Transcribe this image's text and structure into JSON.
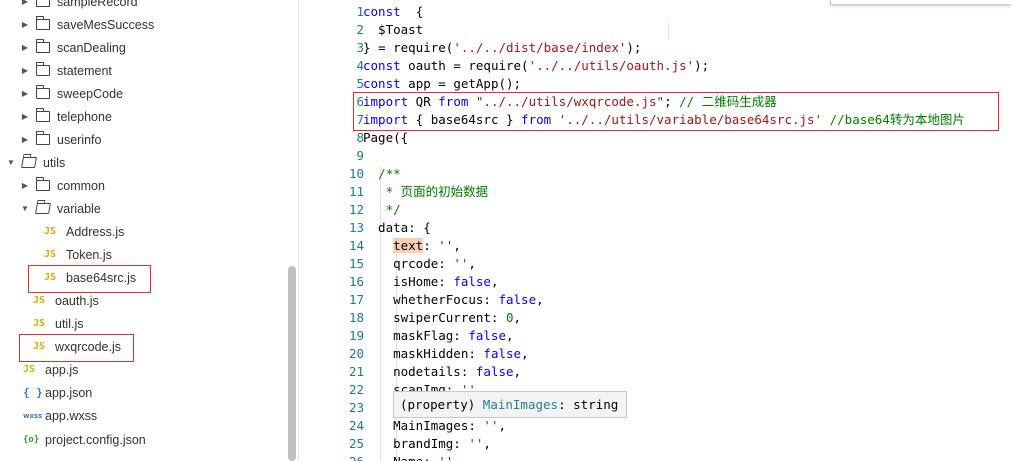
{
  "explorer": {
    "items": [
      {
        "label": "sampleRecord",
        "kind": "folder",
        "arrow": "▶"
      },
      {
        "label": "saveMesSuccess",
        "kind": "folder",
        "arrow": "▶"
      },
      {
        "label": "scanDealing",
        "kind": "folder",
        "arrow": "▶"
      },
      {
        "label": "statement",
        "kind": "folder",
        "arrow": "▶"
      },
      {
        "label": "sweepCode",
        "kind": "folder",
        "arrow": "▶"
      },
      {
        "label": "telephone",
        "kind": "folder",
        "arrow": "▶"
      },
      {
        "label": "userinfo",
        "kind": "folder",
        "arrow": "▶"
      },
      {
        "label": "utils",
        "kind": "folder-open",
        "arrow": "▼"
      },
      {
        "label": "common",
        "kind": "folder",
        "arrow": "▶"
      },
      {
        "label": "variable",
        "kind": "folder-open",
        "arrow": "▼"
      },
      {
        "label": "Address.js",
        "kind": "js",
        "icon_text": "JS"
      },
      {
        "label": "Token.js",
        "kind": "js",
        "icon_text": "JS"
      },
      {
        "label": "base64src.js",
        "kind": "js",
        "icon_text": "JS",
        "highlighted": true
      },
      {
        "label": "oauth.js",
        "kind": "js",
        "icon_text": "JS"
      },
      {
        "label": "util.js",
        "kind": "js",
        "icon_text": "JS"
      },
      {
        "label": "wxqrcode.js",
        "kind": "js",
        "icon_text": "JS",
        "highlighted": true
      },
      {
        "label": "app.js",
        "kind": "js",
        "icon_text": "JS"
      },
      {
        "label": "app.json",
        "kind": "json",
        "icon_text": "{ }"
      },
      {
        "label": "app.wxss",
        "kind": "wxss",
        "icon_text": "wxss"
      },
      {
        "label": "project.config.json",
        "kind": "cfg",
        "icon_text": "{o}"
      }
    ]
  },
  "editor": {
    "lines": [
      {
        "n": "1",
        "tokens": [
          [
            "kw",
            "const"
          ],
          [
            "",
            "  {"
          ]
        ]
      },
      {
        "n": "2",
        "tokens": [
          [
            "",
            "  $Toast"
          ]
        ]
      },
      {
        "n": "3",
        "tokens": [
          [
            "",
            "} = require("
          ],
          [
            "str",
            "'../../dist/base/index'"
          ],
          [
            "",
            ");"
          ]
        ]
      },
      {
        "n": "4",
        "tokens": [
          [
            "kw",
            "const"
          ],
          [
            "",
            " oauth = require("
          ],
          [
            "str",
            "'../../utils/oauth.js'"
          ],
          [
            "",
            ");"
          ]
        ]
      },
      {
        "n": "5",
        "tokens": [
          [
            "kw",
            "const"
          ],
          [
            "",
            " app = getApp();"
          ]
        ]
      },
      {
        "n": "6",
        "tokens": [
          [
            "kw",
            "import"
          ],
          [
            "",
            " QR "
          ],
          [
            "kw",
            "from"
          ],
          [
            "",
            " "
          ],
          [
            "str",
            "\"../../utils/wxqrcode.js\""
          ],
          [
            "",
            "; "
          ],
          [
            "cm",
            "// 二维码生成器"
          ]
        ]
      },
      {
        "n": "7",
        "tokens": [
          [
            "kw",
            "import"
          ],
          [
            "",
            " { base64src } "
          ],
          [
            "kw",
            "from"
          ],
          [
            "",
            " "
          ],
          [
            "str",
            "'../../utils/variable/base64src.js'"
          ],
          [
            "",
            " "
          ],
          [
            "cm",
            "//base64转为本地图片"
          ]
        ]
      },
      {
        "n": "8",
        "tokens": [
          [
            "",
            "Page({"
          ]
        ]
      },
      {
        "n": "9",
        "tokens": []
      },
      {
        "n": "10",
        "tokens": [
          [
            "",
            "  "
          ],
          [
            "cm",
            "/**"
          ]
        ]
      },
      {
        "n": "11",
        "tokens": [
          [
            "",
            "   "
          ],
          [
            "cm",
            "* 页面的初始数据"
          ]
        ]
      },
      {
        "n": "12",
        "tokens": [
          [
            "",
            "   "
          ],
          [
            "cm",
            "*/"
          ]
        ]
      },
      {
        "n": "13",
        "tokens": [
          [
            "",
            "  data: {"
          ]
        ]
      },
      {
        "n": "14",
        "tokens": [
          [
            "",
            "    "
          ],
          [
            "hl",
            "text"
          ],
          [
            "",
            ": "
          ],
          [
            "str",
            "''"
          ],
          [
            "",
            ","
          ]
        ]
      },
      {
        "n": "15",
        "tokens": [
          [
            "",
            "    qrcode: "
          ],
          [
            "str",
            "''"
          ],
          [
            "",
            ","
          ]
        ]
      },
      {
        "n": "16",
        "tokens": [
          [
            "",
            "    isHome: "
          ],
          [
            "kw",
            "false"
          ],
          [
            "",
            ","
          ]
        ]
      },
      {
        "n": "17",
        "tokens": [
          [
            "",
            "    whetherFocus: "
          ],
          [
            "kw",
            "false"
          ],
          [
            "",
            ","
          ]
        ]
      },
      {
        "n": "18",
        "tokens": [
          [
            "",
            "    swiperCurrent: "
          ],
          [
            "cm",
            "0"
          ],
          [
            "",
            ","
          ]
        ]
      },
      {
        "n": "19",
        "tokens": [
          [
            "",
            "    maskFlag: "
          ],
          [
            "kw",
            "false"
          ],
          [
            "",
            ","
          ]
        ]
      },
      {
        "n": "20",
        "tokens": [
          [
            "",
            "    maskHidden: "
          ],
          [
            "kw",
            "false"
          ],
          [
            "",
            ","
          ]
        ]
      },
      {
        "n": "21",
        "tokens": [
          [
            "",
            "    nodetails: "
          ],
          [
            "kw",
            "false"
          ],
          [
            "",
            ","
          ]
        ]
      },
      {
        "n": "22",
        "tokens": [
          [
            "",
            "    scanImg: "
          ],
          [
            "str",
            "''"
          ]
        ]
      },
      {
        "n": "23",
        "tokens": []
      },
      {
        "n": "24",
        "tokens": [
          [
            "",
            "    MainImages: "
          ],
          [
            "str",
            "''"
          ],
          [
            "",
            ","
          ]
        ]
      },
      {
        "n": "25",
        "tokens": [
          [
            "",
            "    brandImg: "
          ],
          [
            "str",
            "''"
          ],
          [
            "",
            ","
          ]
        ]
      },
      {
        "n": "26",
        "tokens": [
          [
            "",
            "    Name: "
          ],
          [
            "str",
            "''"
          ]
        ]
      }
    ],
    "tooltip": {
      "prefix": "(property) ",
      "name": "MainImages",
      "type": ": string"
    }
  }
}
